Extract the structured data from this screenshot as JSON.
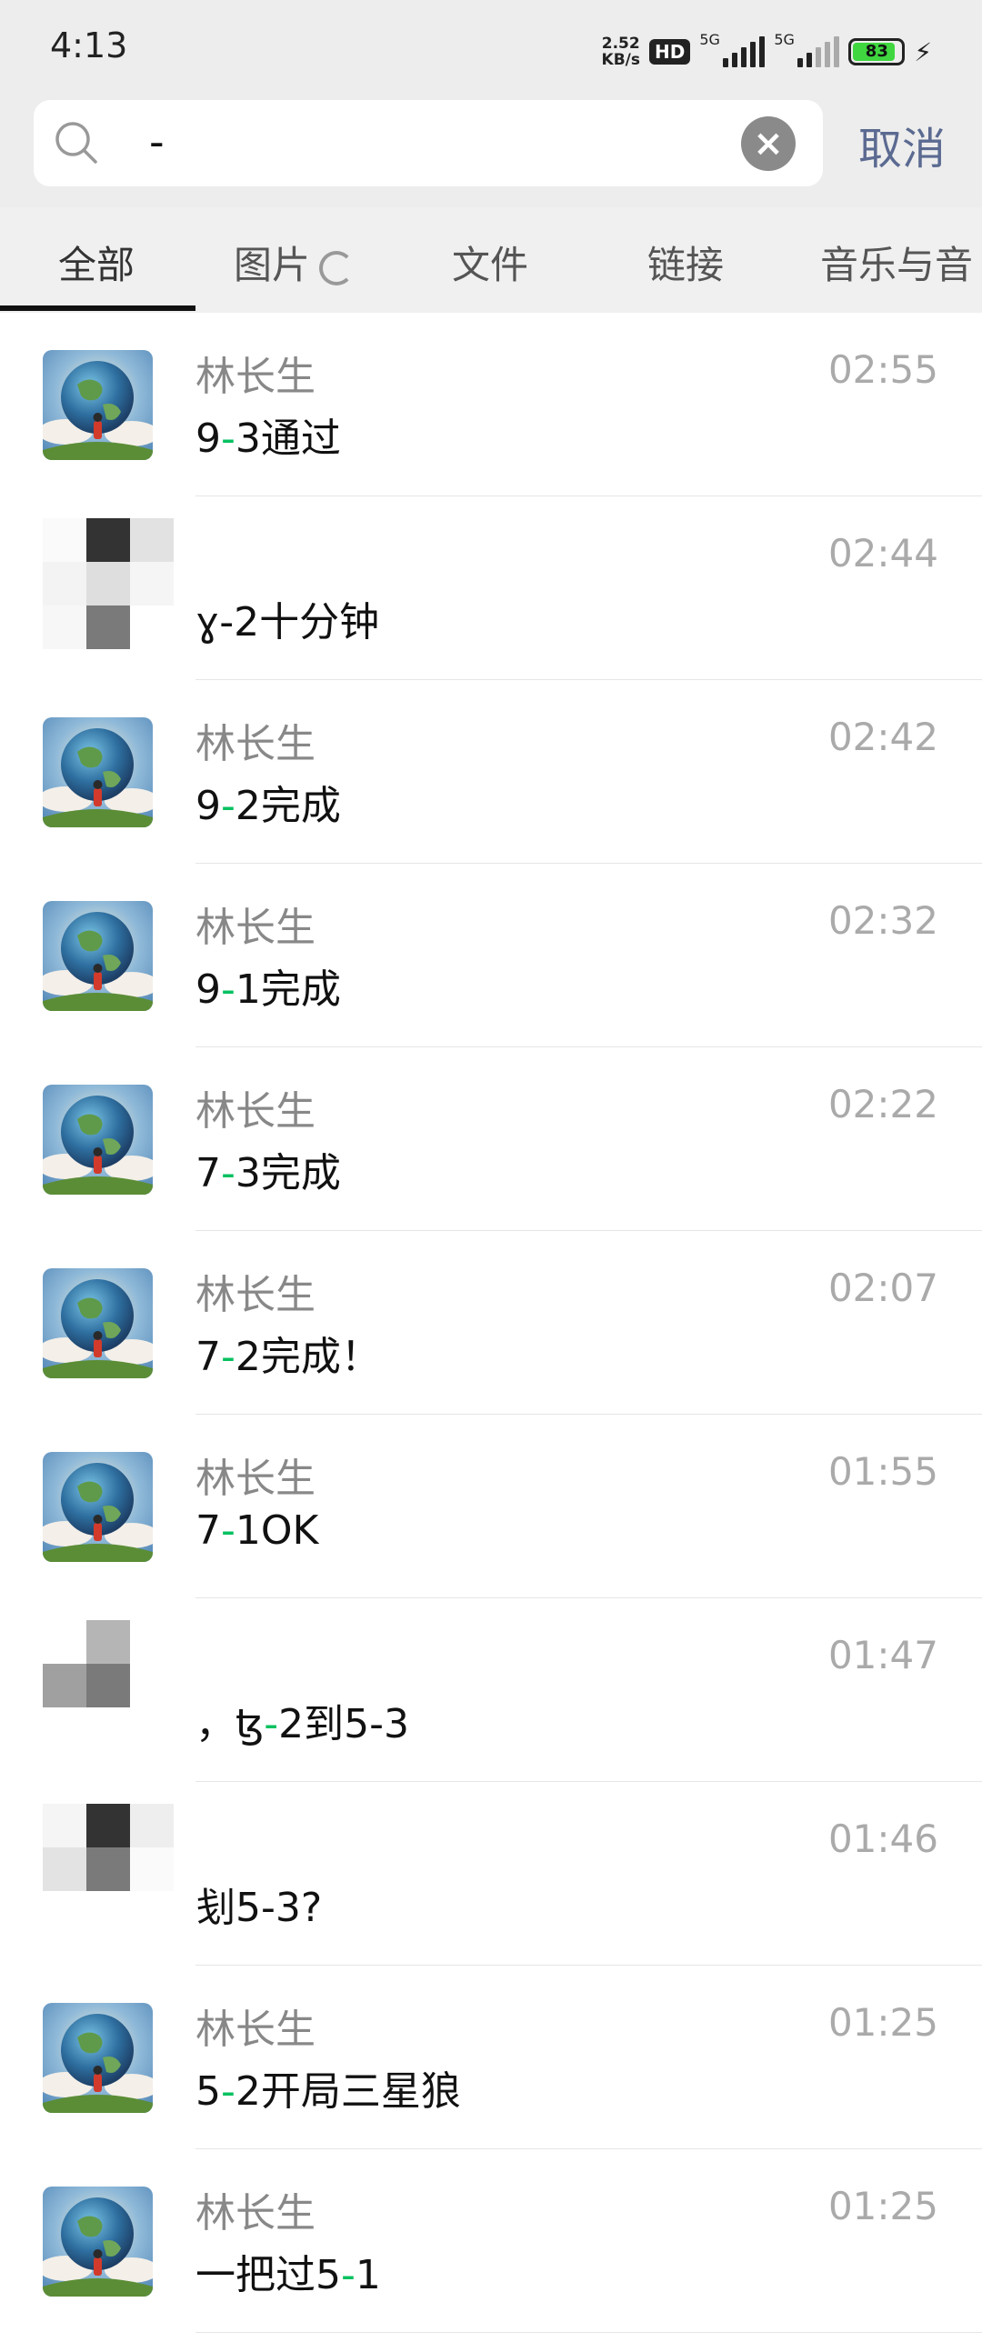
{
  "status_bar": {
    "time": "4:13",
    "net_speed_value": "2.52",
    "net_speed_unit": "KB/s",
    "hd_label": "HD",
    "network1": "5G",
    "network2": "5G",
    "battery": "83",
    "icons": [
      "signal-icon",
      "battery-icon",
      "charging-icon"
    ]
  },
  "search": {
    "query": "-",
    "cancel_label": "取消"
  },
  "tabs": [
    {
      "label": "全部"
    },
    {
      "label": "图片"
    },
    {
      "label": "文件"
    },
    {
      "label": "链接"
    },
    {
      "label": "音乐与音"
    }
  ],
  "results": [
    {
      "name": "林长生",
      "time": "02:55",
      "pre": "9",
      "hl": "-",
      "post": "3通过",
      "avatar": "earth"
    },
    {
      "name": "",
      "time": "02:44",
      "pre": "ɣ-2十分钟",
      "hl": "",
      "post": "",
      "avatar": "mosaic"
    },
    {
      "name": "林长生",
      "time": "02:42",
      "pre": "9",
      "hl": "-",
      "post": "2完成",
      "avatar": "earth"
    },
    {
      "name": "林长生",
      "time": "02:32",
      "pre": "9",
      "hl": "-",
      "post": "1完成",
      "avatar": "earth"
    },
    {
      "name": "林长生",
      "time": "02:22",
      "pre": "7",
      "hl": "-",
      "post": "3完成",
      "avatar": "earth"
    },
    {
      "name": "林长生",
      "time": "02:07",
      "pre": "7",
      "hl": "-",
      "post": "2完成！",
      "avatar": "earth"
    },
    {
      "name": "林长生",
      "time": "01:55",
      "pre": "7",
      "hl": "-",
      "post": "1OK",
      "avatar": "earth"
    },
    {
      "name": "",
      "time": "01:47",
      "pre": "，ꜩ",
      "hl": "-",
      "post": "2到5-3",
      "avatar": "mosaic"
    },
    {
      "name": "",
      "time": "01:46",
      "pre": "刬5-3?",
      "hl": "",
      "post": "",
      "avatar": "mosaic"
    },
    {
      "name": "林长生",
      "time": "01:25",
      "pre": "5",
      "hl": "-",
      "post": "2开局三星狼",
      "avatar": "earth"
    },
    {
      "name": "林长生",
      "time": "01:25",
      "pre": "一把过5",
      "hl": "-",
      "post": "1",
      "avatar": "earth"
    }
  ],
  "colors": {
    "highlight": "#07c160",
    "cancel": "#5b6a91",
    "background": "#ededed"
  }
}
